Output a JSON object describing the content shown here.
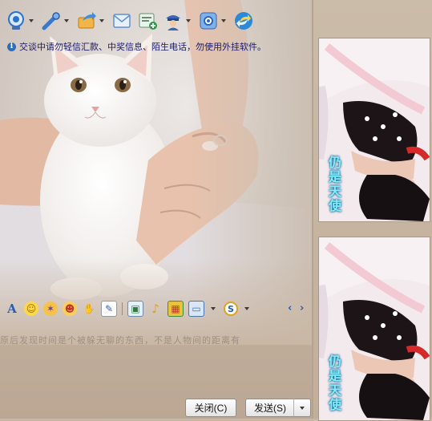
{
  "toolbar": {
    "items": [
      {
        "name": "video-icon",
        "color": "#2c73c8"
      },
      {
        "name": "voice-icon",
        "color": "#3a78c9"
      },
      {
        "name": "send-file-icon",
        "color": "#e98a1a"
      },
      {
        "name": "message-icon",
        "color": "#5f8fd0"
      },
      {
        "name": "app-icon",
        "color": "#2c9b4a"
      },
      {
        "name": "user-icon",
        "color": "#3a66b5"
      },
      {
        "name": "settings-icon",
        "color": "#4f8ad5"
      },
      {
        "name": "more-icon",
        "color": "#2b8ad8"
      }
    ]
  },
  "notice": {
    "text": "交谈中请勿轻信汇款、中奖信息、陌生电话，勿使用外挂软件。"
  },
  "format_toolbar": {
    "items": [
      {
        "name": "font-icon",
        "glyph": "A"
      },
      {
        "name": "emoji-icon",
        "glyph": "☺"
      },
      {
        "name": "magic-emoji-icon",
        "glyph": "✶"
      },
      {
        "name": "wink-icon",
        "glyph": "☻"
      },
      {
        "name": "hand-icon",
        "glyph": "✋"
      },
      {
        "name": "doodle-icon",
        "glyph": "✎"
      },
      {
        "name": "image-icon",
        "glyph": "▣"
      },
      {
        "name": "music-icon",
        "glyph": "♪"
      },
      {
        "name": "gift-icon",
        "glyph": "▦"
      },
      {
        "name": "screenshot-icon",
        "glyph": "▭"
      },
      {
        "name": "search-icon",
        "glyph": "S"
      }
    ],
    "nav_prev": "‹",
    "nav_next": "›"
  },
  "signature": "原后发现时间是个被躲无聊的东西，不是人物间的距离有",
  "buttons": {
    "close": "关闭(C)",
    "send": "发送(S)"
  },
  "side_pictures": [
    {
      "caption": "仍是天使"
    },
    {
      "caption": "仍是天使"
    }
  ]
}
